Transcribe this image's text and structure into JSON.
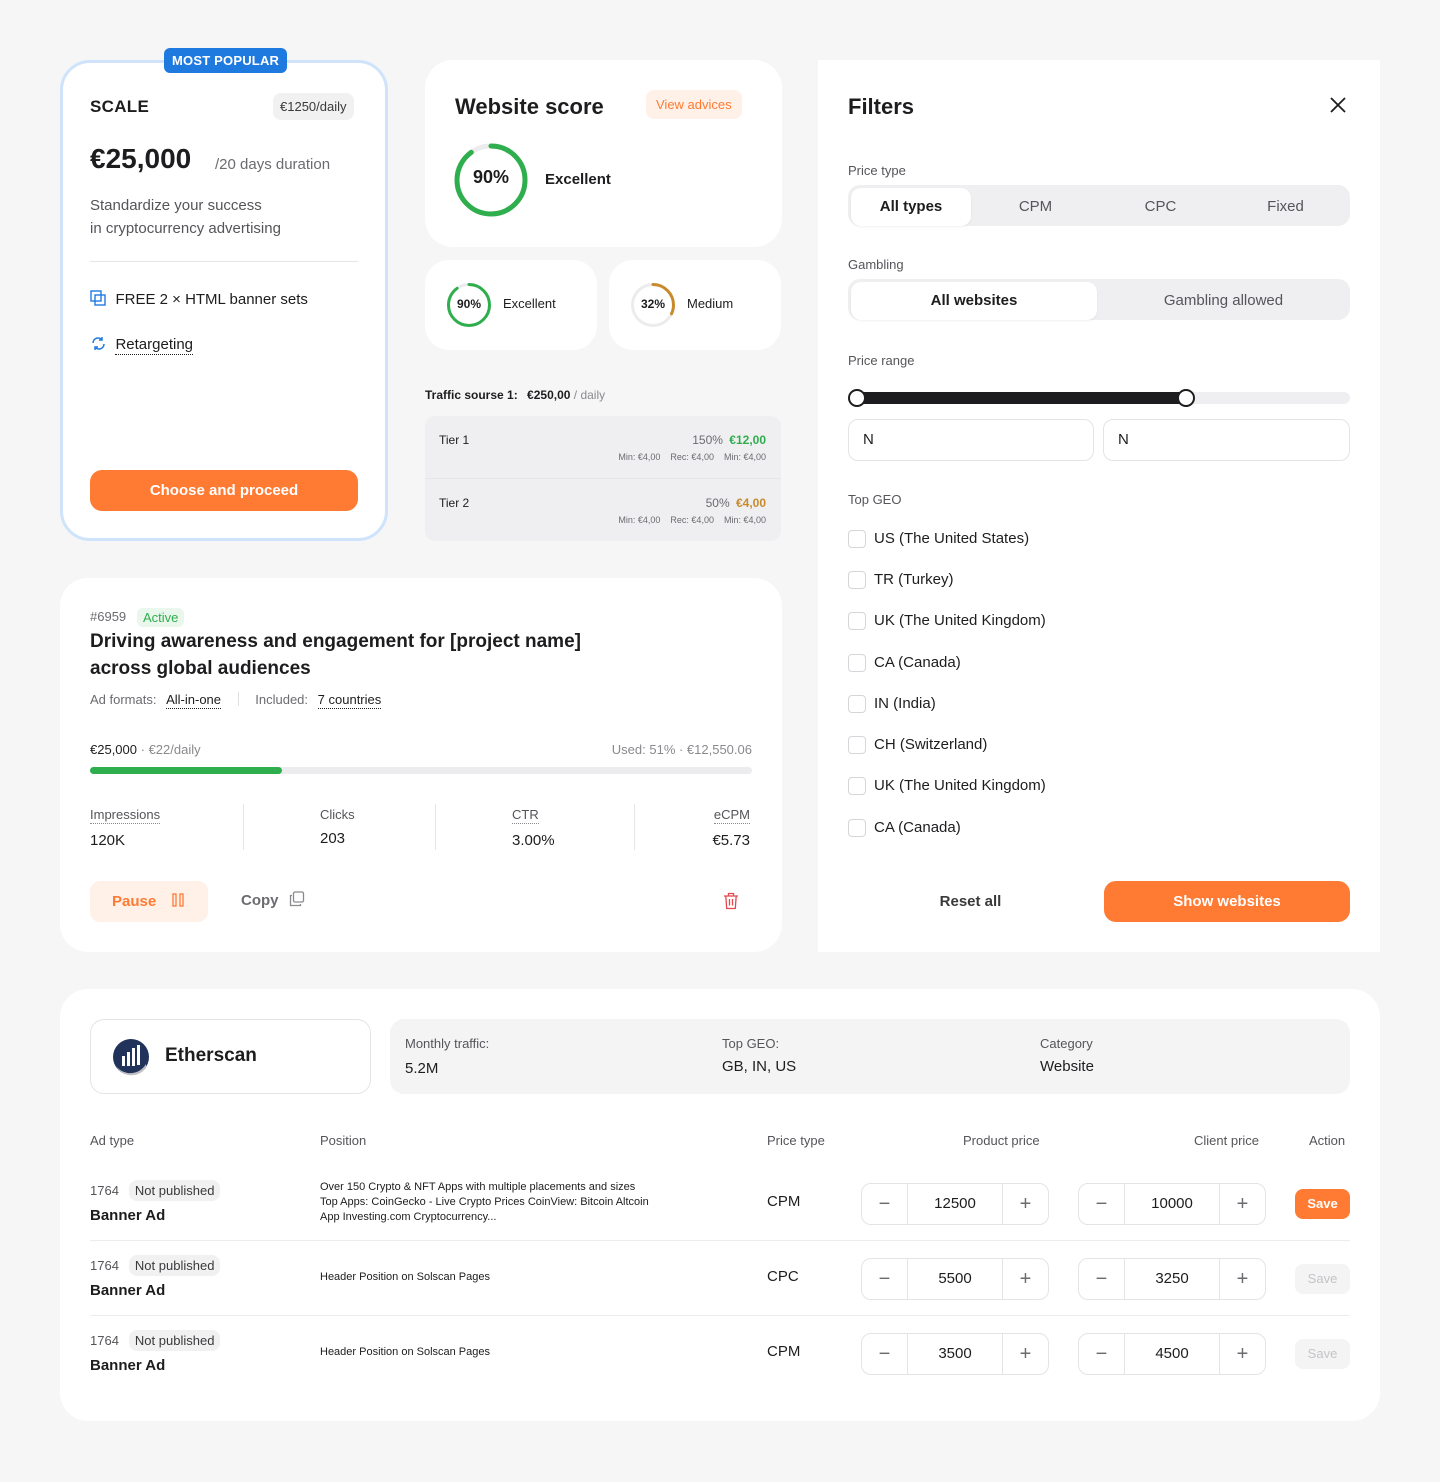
{
  "plan": {
    "badge": "MOST POPULAR",
    "name": "SCALE",
    "daily": "€1250/daily",
    "price": "€25,000",
    "duration": "/20 days duration",
    "desc1": "Standardize your success",
    "desc2": "in cryptocurrency advertising",
    "features": [
      "FREE 2 × HTML banner sets",
      "Retargeting"
    ],
    "cta": "Choose and proceed"
  },
  "score": {
    "title": "Website score",
    "advices": "View advices",
    "main_value": "90%",
    "main_percent": 90,
    "main_label": "Excellent",
    "small": [
      {
        "value": "90%",
        "percent": 90,
        "label": "Excellent",
        "color": "#2fae4e"
      },
      {
        "value": "32%",
        "percent": 32,
        "label": "Medium",
        "color": "#c98a2b"
      }
    ]
  },
  "traffic": {
    "label": "Traffic sourse 1:",
    "amount": "€250,00",
    "period": "/ daily",
    "tiers": [
      {
        "name": "Tier 1",
        "pct": "150%",
        "price": "€12,00",
        "price_color": "#2fae4e",
        "min": "Min: €4,00",
        "rec": "Rec: €4,00",
        "min2": "Min: €4,00"
      },
      {
        "name": "Tier 2",
        "pct": "50%",
        "price": "€4,00",
        "price_color": "#c98a2b",
        "min": "Min: €4,00",
        "rec": "Rec: €4,00",
        "min2": "Min: €4,00"
      }
    ]
  },
  "campaign": {
    "id": "#6959",
    "status": "Active",
    "title1": "Driving awareness and engagement for [project name]",
    "title2": "across global audiences",
    "formats_label": "Ad formats:",
    "formats_value": "All-in-one",
    "included_label": "Included:",
    "included_value": "7 countries",
    "budget": "€25,000",
    "budget_daily": "· €22/daily",
    "used": "Used: 51% · €12,550.06",
    "used_percent": 29,
    "stats": [
      {
        "label": "Impressions",
        "value": "120K"
      },
      {
        "label": "Clicks",
        "value": "203"
      },
      {
        "label": "CTR",
        "value": "3.00%"
      },
      {
        "label": "eCPM",
        "value": "€5.73"
      }
    ],
    "pause": "Pause",
    "copy": "Copy"
  },
  "filters": {
    "title": "Filters",
    "price_type_label": "Price type",
    "price_types": [
      "All types",
      "CPM",
      "CPC",
      "Fixed"
    ],
    "gambling_label": "Gambling",
    "gambling": [
      "All websites",
      "Gambling allowed"
    ],
    "range_label": "Price range",
    "range_min_percent": 0,
    "range_max_percent": 68,
    "min_value": "N",
    "max_value": "N",
    "geo_label": "Top GEO",
    "geos": [
      "US (The United States)",
      "TR (Turkey)",
      "UK (The United Kingdom)",
      "CA (Canada)",
      "IN (India)",
      "CH (Switzerland)",
      "UK (The United Kingdom)",
      "CA (Canada)"
    ],
    "reset": "Reset all",
    "show": "Show websites"
  },
  "site": {
    "name": "Etherscan",
    "traffic_label": "Monthly traffic:",
    "traffic_value": "5.2M",
    "geo_label": "Top GEO:",
    "geo_value": "GB, IN, US",
    "category_label": "Category",
    "category_value": "Website",
    "headers": [
      "Ad type",
      "Position",
      "Price type",
      "Product price",
      "Client price",
      "Action"
    ],
    "rows": [
      {
        "id": "1764",
        "status": "Not published",
        "type": "Banner Ad",
        "position": "Over 150 Crypto & NFT Apps with multiple placements and sizes Top Apps: CoinGecko - Live Crypto Prices CoinView: Bitcoin Altcoin App Investing.com Cryptocurrency...",
        "price_type": "CPM",
        "product": "12500",
        "client": "10000",
        "save": "Save"
      },
      {
        "id": "1764",
        "status": "Not published",
        "type": "Banner Ad",
        "position": "Header Position on Solscan Pages",
        "price_type": "CPC",
        "product": "5500",
        "client": "3250",
        "save": "Save"
      },
      {
        "id": "1764",
        "status": "Not published",
        "type": "Banner Ad",
        "position": "Header Position on Solscan Pages",
        "price_type": "CPM",
        "product": "3500",
        "client": "4500",
        "save": "Save"
      }
    ]
  }
}
